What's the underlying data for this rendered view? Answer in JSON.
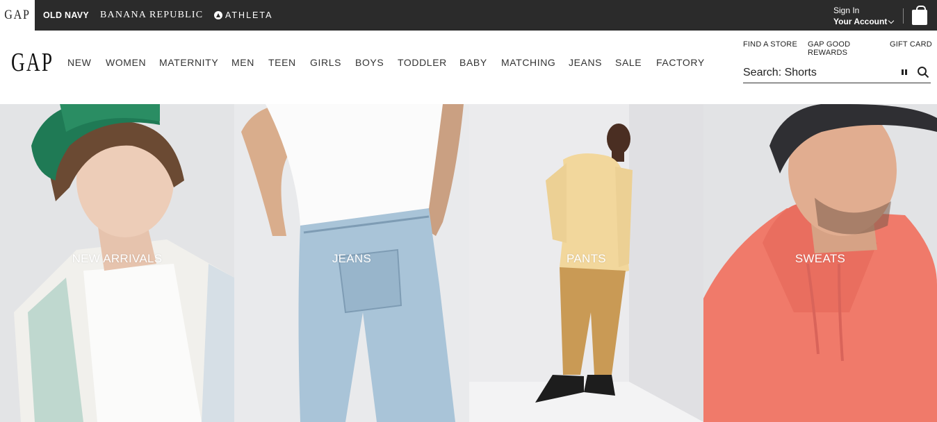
{
  "brand_bar": {
    "brands": [
      {
        "label": "GAP",
        "icon": "gap-logo"
      },
      {
        "label": "OLD NAVY"
      },
      {
        "label": "BANANA REPUBLIC"
      },
      {
        "label": "ATHLETA",
        "icon": "athleta-logo-icon"
      }
    ],
    "account": {
      "sign_in": "Sign In",
      "your_account": "Your Account"
    },
    "bag_icon": "shopping-bag-icon",
    "colors": {
      "background": "#2b2b2b",
      "text": "#ffffff"
    }
  },
  "header": {
    "logo": "GAP",
    "nav": [
      "NEW",
      "WOMEN",
      "MATERNITY",
      "MEN",
      "TEEN",
      "GIRLS",
      "BOYS",
      "TODDLER",
      "BABY",
      "MATCHING",
      "JEANS",
      "SALE",
      "FACTORY"
    ],
    "utility_links": {
      "find_store": "FIND A STORE",
      "rewards": "GAP GOOD REWARDS",
      "gift_card": "GIFT CARD"
    },
    "search": {
      "placeholder": "Search: Shorts",
      "pause_icon": "pause-icon",
      "search_icon": "search-icon"
    }
  },
  "hero": {
    "panels": [
      {
        "label": "NEW ARRIVALS"
      },
      {
        "label": "JEANS"
      },
      {
        "label": "PANTS"
      },
      {
        "label": "SWEATS"
      }
    ]
  }
}
